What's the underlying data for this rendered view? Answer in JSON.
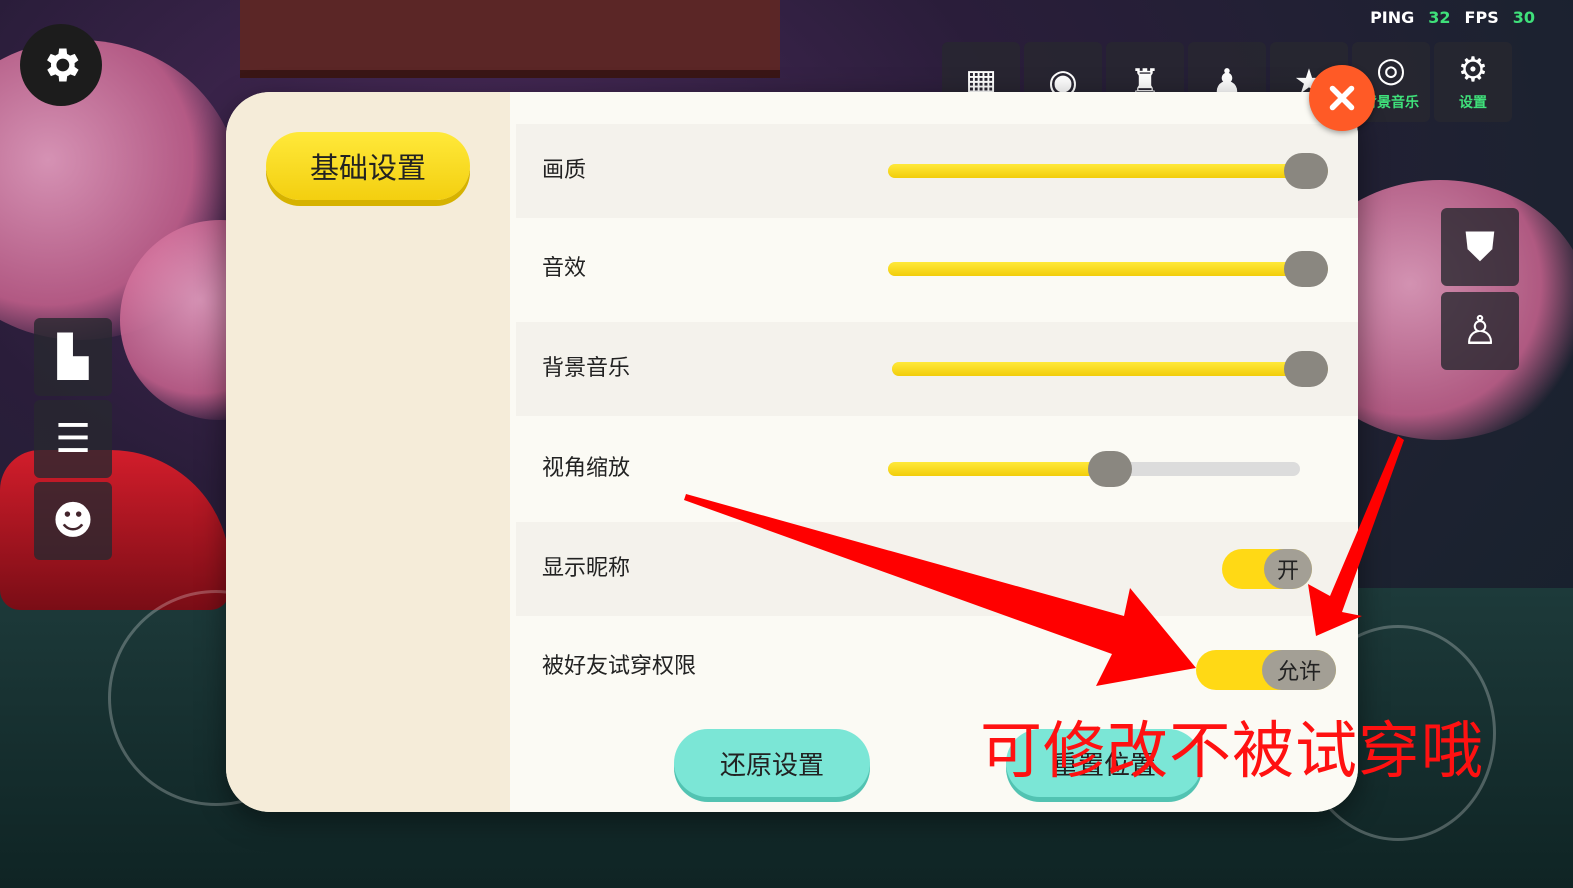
{
  "hud": {
    "ping_label": "PING",
    "ping_value": "32",
    "fps_label": "FPS",
    "fps_value": "30"
  },
  "toolbar": [
    {
      "icon": "calendar-icon",
      "label": ""
    },
    {
      "icon": "profile-icon",
      "label": ""
    },
    {
      "icon": "outfit-icon",
      "label": ""
    },
    {
      "icon": "wardrobe-icon",
      "label": ""
    },
    {
      "icon": "favorite-icon",
      "label": ""
    },
    {
      "icon": "music-disc-icon",
      "label": "背景音乐"
    },
    {
      "icon": "gear-icon",
      "label": "设置"
    }
  ],
  "modal": {
    "category_label": "基础设置",
    "settings": [
      {
        "label": "画质",
        "type": "slider",
        "value": 1.0
      },
      {
        "label": "音效",
        "type": "slider",
        "value": 1.0
      },
      {
        "label": "背景音乐",
        "type": "slider",
        "value": 1.0
      },
      {
        "label": "视角缩放",
        "type": "slider",
        "value": 0.54
      },
      {
        "label": "显示昵称",
        "type": "toggle",
        "state": "开"
      },
      {
        "label": "被好友试穿权限",
        "type": "toggle",
        "state": "允许"
      }
    ],
    "restore_button": "还原设置",
    "reset_position_button": "重置位置"
  },
  "annotation": {
    "text": "可修改不被试穿哦",
    "color": "#ff1111"
  },
  "colors": {
    "accent_yellow": "#ffd915",
    "close_orange": "#ff5a26",
    "button_teal": "#7be6d6"
  }
}
